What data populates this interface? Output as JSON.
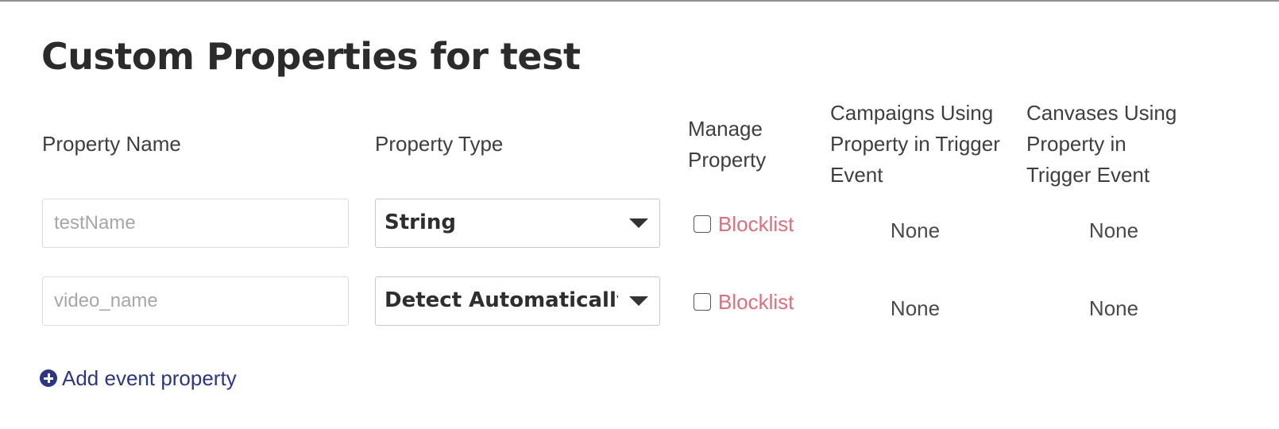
{
  "page": {
    "title": "Custom Properties for test"
  },
  "table": {
    "headers": {
      "property_name": "Property Name",
      "property_type": "Property Type",
      "manage_property": "Manage Property",
      "campaigns_using": "Campaigns Using Property in Trigger Event",
      "canvases_using": "Canvases Using Property in Trigger Event"
    },
    "rows": [
      {
        "name_placeholder": "testName",
        "type": "String",
        "blocklist_label": "Blocklist",
        "blocklist_checked": false,
        "campaigns": "None",
        "canvases": "None"
      },
      {
        "name_placeholder": "video_name",
        "type": "Detect Automatically (",
        "blocklist_label": "Blocklist",
        "blocklist_checked": false,
        "campaigns": "None",
        "canvases": "None"
      }
    ]
  },
  "actions": {
    "add_property_label": "Add event property",
    "add_property_icon": "plus-circle-icon"
  },
  "colors": {
    "title": "#2b2b2b",
    "blocklist": "#e06e7c",
    "add_link": "#2d3586",
    "placeholder": "#a7a7a7"
  }
}
